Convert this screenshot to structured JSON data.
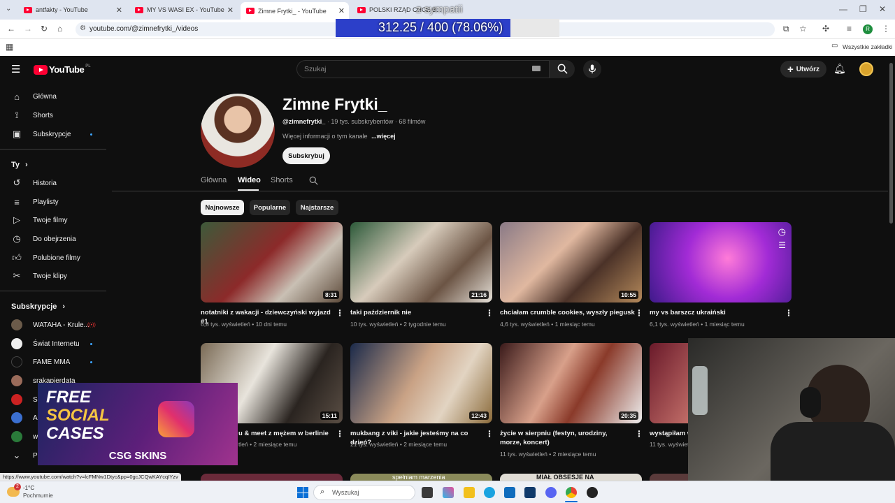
{
  "browser": {
    "tabs": [
      {
        "title": "antfakty - YouTube",
        "active": false
      },
      {
        "title": "MY VS WASI EX - YouTube",
        "active": false
      },
      {
        "title": "Zimne Frytki_ - YouTube",
        "active": true
      },
      {
        "title": "POLSKI RZĄD CHCE B...",
        "active": false
      }
    ],
    "url": "youtube.com/@zimnefrytki_/videos",
    "bookmarks_label": "Wszystkie zakładki",
    "profile_initial": "R",
    "status_url": "https://www.youtube.com/watch?v=lcFMNw1Dtyc&pp=0gcJCQwKAYcqIYzv"
  },
  "stream_overlay": {
    "goal_text": "312.25 / 400 (78.06%)",
    "goal_progress": 0.7806,
    "goal_sublabel": "z sympatii"
  },
  "youtube": {
    "logo_text": "YouTube",
    "logo_region": "PL",
    "search_placeholder": "Szukaj",
    "create_label": "Utwórz",
    "sidebar": {
      "main": [
        {
          "label": "Główna",
          "icon": "home-icon"
        },
        {
          "label": "Shorts",
          "icon": "shorts-icon"
        },
        {
          "label": "Subskrypcje",
          "icon": "subscriptions-icon"
        }
      ],
      "you_header": "Ty",
      "you": [
        {
          "label": "Historia",
          "icon": "history-icon"
        },
        {
          "label": "Playlisty",
          "icon": "playlists-icon"
        },
        {
          "label": "Twoje filmy",
          "icon": "your-videos-icon"
        },
        {
          "label": "Do obejrzenia",
          "icon": "watch-later-icon"
        },
        {
          "label": "Polubione filmy",
          "icon": "liked-icon"
        },
        {
          "label": "Twoje klipy",
          "icon": "clips-icon"
        }
      ],
      "subs_header": "Subskrypcje",
      "subs": [
        {
          "label": "WATAHA - Krule..."
        },
        {
          "label": "Świat Internetu"
        },
        {
          "label": "FAME MMA"
        },
        {
          "label": "srakapierdata"
        },
        {
          "label": "Sr"
        },
        {
          "label": "A"
        },
        {
          "label": "w"
        },
        {
          "label": "Pr"
        }
      ]
    },
    "channel": {
      "name": "Zimne Frytki_",
      "handle": "@zimnefrytki_",
      "subscribers": "19 tys. subskrybentów",
      "video_count": "68 filmów",
      "about": "Więcej informacji o tym kanale",
      "more": "...więcej",
      "subscribe_label": "Subskrybuj",
      "tabs": [
        "Główna",
        "Wideo",
        "Shorts"
      ]
    },
    "chips": [
      "Najnowsze",
      "Popularne",
      "Najstarsze"
    ],
    "videos_row1": [
      {
        "title": "notatniki z wakacji - dziewczyński wyjazd #1",
        "views": "6,8 tys. wyświetleń",
        "age": "10 dni temu",
        "duration": "8:31"
      },
      {
        "title": "taki październik nie",
        "views": "10 tys. wyświetleń",
        "age": "2 tygodnie temu",
        "duration": "21:16"
      },
      {
        "title": "chciałam crumble cookies, wyszły piegusk",
        "views": "4,6 tys. wyświetleń",
        "age": "1 miesiąc temu",
        "duration": "10:55"
      },
      {
        "title": "my vs barszcz ukraiński",
        "views": "6,1 tys. wyświetleń",
        "age": "1 miesiąc temu",
        "duration": ""
      }
    ],
    "videos_row2": [
      {
        "title": "u & meet z mężem w berlinie",
        "views": "tleń",
        "age": "2 miesiące temu",
        "duration": "15:11"
      },
      {
        "title": "mukbang z viki - jakie jesteśmy na co dzień?",
        "views": "21 tys. wyświetleń",
        "age": "2 miesiące temu",
        "duration": "12:43"
      },
      {
        "title": "życie w sierpniu (festyn, urodziny, morze, koncert)",
        "views": "11 tys. wyświetleń",
        "age": "2 miesiące temu",
        "duration": "20:35"
      },
      {
        "title": "wystąpiłam w",
        "views": "11 tys. wyświetleń",
        "age": "",
        "duration": ""
      }
    ],
    "row3_captions": [
      "",
      "spełniam marzenia",
      "MIAŁ OBSESJE NA",
      ""
    ]
  },
  "promo": {
    "line1": "FREE",
    "line2": "SOCIAL",
    "line3": "CASES",
    "brand": "CSG SKINS"
  },
  "taskbar": {
    "weather_temp": "-1°C",
    "weather_desc": "Pochmurnie",
    "search_placeholder": "Wyszukaj",
    "notif_count": "2"
  },
  "colors": {
    "accent_blue": "#3ea6ff",
    "yt_red": "#ff0033",
    "overlay_fill": "#2c3fc9"
  }
}
